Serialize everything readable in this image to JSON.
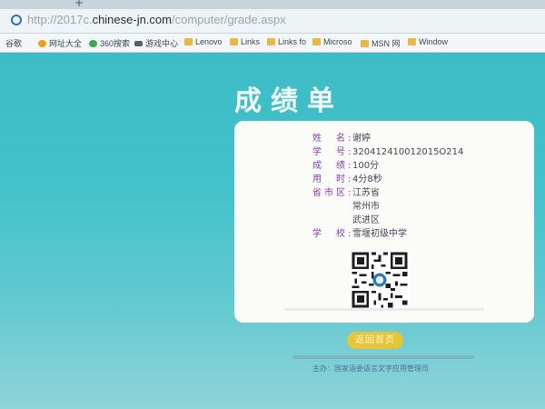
{
  "browser": {
    "new_tab_symbol": "+",
    "url_prefix": "http://2017c.",
    "url_domain": "chinese-jn.com",
    "url_path": "/computer/grade.aspx",
    "favorites": [
      {
        "label": "谷歌",
        "icon": "page-icon"
      },
      {
        "label": "网址大全",
        "icon": "browser-logo-icon"
      },
      {
        "label": "360搜索",
        "icon": "search360-icon"
      },
      {
        "label": "游戏中心",
        "icon": "gamepad-icon"
      },
      {
        "label": "Lenovo",
        "icon": "folder-icon"
      },
      {
        "label": "Links",
        "icon": "folder-icon"
      },
      {
        "label": "Links fo",
        "icon": "folder-icon"
      },
      {
        "label": "Microso",
        "icon": "folder-icon"
      },
      {
        "label": "MSN 网",
        "icon": "folder-icon"
      },
      {
        "label": "Window",
        "icon": "folder-icon"
      }
    ]
  },
  "page": {
    "title": "成绩单",
    "fields": [
      {
        "label": "姓　名:",
        "value": "谢婷"
      },
      {
        "label": "学　号:",
        "value": "320412410012015O214"
      },
      {
        "label": "成　绩:",
        "value": "100分"
      },
      {
        "label": "用　时:",
        "value": "4分8秒"
      },
      {
        "label": "省市区:",
        "value": "江苏省"
      },
      {
        "label": "",
        "value": "常州市"
      },
      {
        "label": "",
        "value": "武进区"
      },
      {
        "label": "学　校:",
        "value": "雪堰初级中学"
      }
    ],
    "home_button": "返回首页",
    "organizer": "主办：国家语委语言文字应用管理司"
  },
  "colors": {
    "page_bg": "#45c2cb",
    "label": "#8a3ab0",
    "button": "#e5c53a"
  }
}
